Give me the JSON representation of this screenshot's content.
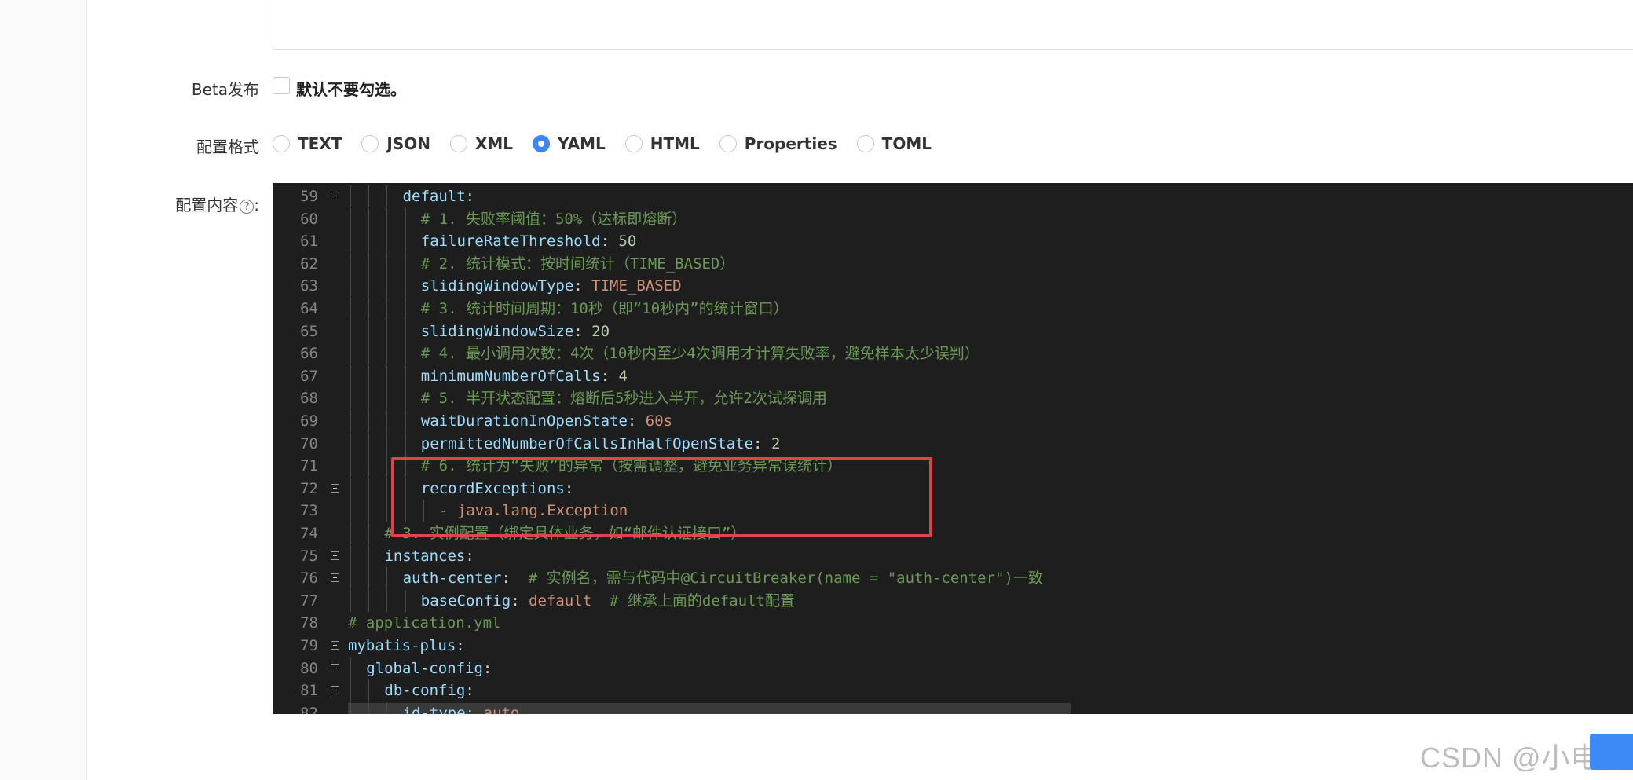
{
  "form": {
    "beta_label": "Beta发布",
    "beta_checkbox_text": "默认不要勾选。",
    "format_label": "配置格式",
    "content_label": "配置内容",
    "content_help": "?",
    "content_colon": ":",
    "formats": [
      {
        "label": "TEXT",
        "checked": false
      },
      {
        "label": "JSON",
        "checked": false
      },
      {
        "label": "XML",
        "checked": false
      },
      {
        "label": "YAML",
        "checked": true
      },
      {
        "label": "HTML",
        "checked": false
      },
      {
        "label": "Properties",
        "checked": false
      },
      {
        "label": "TOML",
        "checked": false
      }
    ]
  },
  "editor": {
    "lines": [
      {
        "num": "59",
        "fold": true,
        "indent": 3,
        "tokens": [
          {
            "t": "default",
            "c": "k"
          },
          {
            "t": ":",
            "c": "p"
          }
        ]
      },
      {
        "num": "60",
        "fold": false,
        "indent": 4,
        "tokens": [
          {
            "t": "# 1. 失败率阈值：50%（达标即熔断）",
            "c": "c"
          }
        ]
      },
      {
        "num": "61",
        "fold": false,
        "indent": 4,
        "tokens": [
          {
            "t": "failureRateThreshold",
            "c": "k"
          },
          {
            "t": ": ",
            "c": "p"
          },
          {
            "t": "50",
            "c": "n"
          }
        ]
      },
      {
        "num": "62",
        "fold": false,
        "indent": 4,
        "tokens": [
          {
            "t": "# 2. 统计模式：按时间统计（TIME_BASED）",
            "c": "c"
          }
        ]
      },
      {
        "num": "63",
        "fold": false,
        "indent": 4,
        "tokens": [
          {
            "t": "slidingWindowType",
            "c": "k"
          },
          {
            "t": ": ",
            "c": "p"
          },
          {
            "t": "TIME_BASED",
            "c": "s"
          }
        ]
      },
      {
        "num": "64",
        "fold": false,
        "indent": 4,
        "tokens": [
          {
            "t": "# 3. 统计时间周期：10秒（即“10秒内”的统计窗口）",
            "c": "c"
          }
        ]
      },
      {
        "num": "65",
        "fold": false,
        "indent": 4,
        "tokens": [
          {
            "t": "slidingWindowSize",
            "c": "k"
          },
          {
            "t": ": ",
            "c": "p"
          },
          {
            "t": "20",
            "c": "n"
          }
        ]
      },
      {
        "num": "66",
        "fold": false,
        "indent": 4,
        "tokens": [
          {
            "t": "# 4. 最小调用次数：4次（10秒内至少4次调用才计算失败率，避免样本太少误判）",
            "c": "c"
          }
        ]
      },
      {
        "num": "67",
        "fold": false,
        "indent": 4,
        "tokens": [
          {
            "t": "minimumNumberOfCalls",
            "c": "k"
          },
          {
            "t": ": ",
            "c": "p"
          },
          {
            "t": "4",
            "c": "n"
          }
        ]
      },
      {
        "num": "68",
        "fold": false,
        "indent": 4,
        "tokens": [
          {
            "t": "# 5. 半开状态配置：熔断后5秒进入半开，允许2次试探调用",
            "c": "c"
          }
        ]
      },
      {
        "num": "69",
        "fold": false,
        "indent": 4,
        "tokens": [
          {
            "t": "waitDurationInOpenState",
            "c": "k"
          },
          {
            "t": ": ",
            "c": "p"
          },
          {
            "t": "60s",
            "c": "s"
          }
        ]
      },
      {
        "num": "70",
        "fold": false,
        "indent": 4,
        "tokens": [
          {
            "t": "permittedNumberOfCallsInHalfOpenState",
            "c": "k"
          },
          {
            "t": ": ",
            "c": "p"
          },
          {
            "t": "2",
            "c": "n"
          }
        ]
      },
      {
        "num": "71",
        "fold": false,
        "indent": 4,
        "tokens": [
          {
            "t": "# 6. 统计为“失败”的异常（按需调整，避免业务异常误统计）",
            "c": "c"
          }
        ]
      },
      {
        "num": "72",
        "fold": true,
        "indent": 4,
        "tokens": [
          {
            "t": "recordExceptions",
            "c": "k"
          },
          {
            "t": ":",
            "c": "p"
          }
        ]
      },
      {
        "num": "73",
        "fold": false,
        "indent": 5,
        "tokens": [
          {
            "t": "- ",
            "c": "p"
          },
          {
            "t": "java.lang.Exception",
            "c": "s"
          }
        ]
      },
      {
        "num": "74",
        "fold": false,
        "indent": 2,
        "tokens": [
          {
            "t": "# 3. 实例配置（绑定具体业务，如“邮件认证接口”）",
            "c": "c"
          }
        ]
      },
      {
        "num": "75",
        "fold": true,
        "indent": 2,
        "tokens": [
          {
            "t": "instances",
            "c": "k"
          },
          {
            "t": ":",
            "c": "p"
          }
        ]
      },
      {
        "num": "76",
        "fold": true,
        "indent": 3,
        "tokens": [
          {
            "t": "auth-center",
            "c": "k"
          },
          {
            "t": ":  ",
            "c": "p"
          },
          {
            "t": "# 实例名，需与代码中@CircuitBreaker(name = \"auth-center\")一致",
            "c": "c"
          }
        ]
      },
      {
        "num": "77",
        "fold": false,
        "indent": 4,
        "tokens": [
          {
            "t": "baseConfig",
            "c": "k"
          },
          {
            "t": ": ",
            "c": "p"
          },
          {
            "t": "default",
            "c": "s"
          },
          {
            "t": "  ",
            "c": "p"
          },
          {
            "t": "# 继承上面的default配置",
            "c": "c"
          }
        ]
      },
      {
        "num": "78",
        "fold": false,
        "indent": 0,
        "tokens": [
          {
            "t": "# application.yml",
            "c": "c"
          }
        ]
      },
      {
        "num": "79",
        "fold": true,
        "indent": 0,
        "tokens": [
          {
            "t": "mybatis-plus",
            "c": "k"
          },
          {
            "t": ":",
            "c": "p"
          }
        ]
      },
      {
        "num": "80",
        "fold": true,
        "indent": 1,
        "tokens": [
          {
            "t": "global-config",
            "c": "k"
          },
          {
            "t": ":",
            "c": "p"
          }
        ]
      },
      {
        "num": "81",
        "fold": true,
        "indent": 2,
        "tokens": [
          {
            "t": "db-config",
            "c": "k"
          },
          {
            "t": ":",
            "c": "p"
          }
        ]
      },
      {
        "num": "82",
        "fold": false,
        "indent": 3,
        "tokens": [
          {
            "t": "id-type",
            "c": "k"
          },
          {
            "t": ": ",
            "c": "p"
          },
          {
            "t": "auto",
            "c": "s"
          }
        ]
      }
    ]
  },
  "watermark": "CSDN @小电玩"
}
